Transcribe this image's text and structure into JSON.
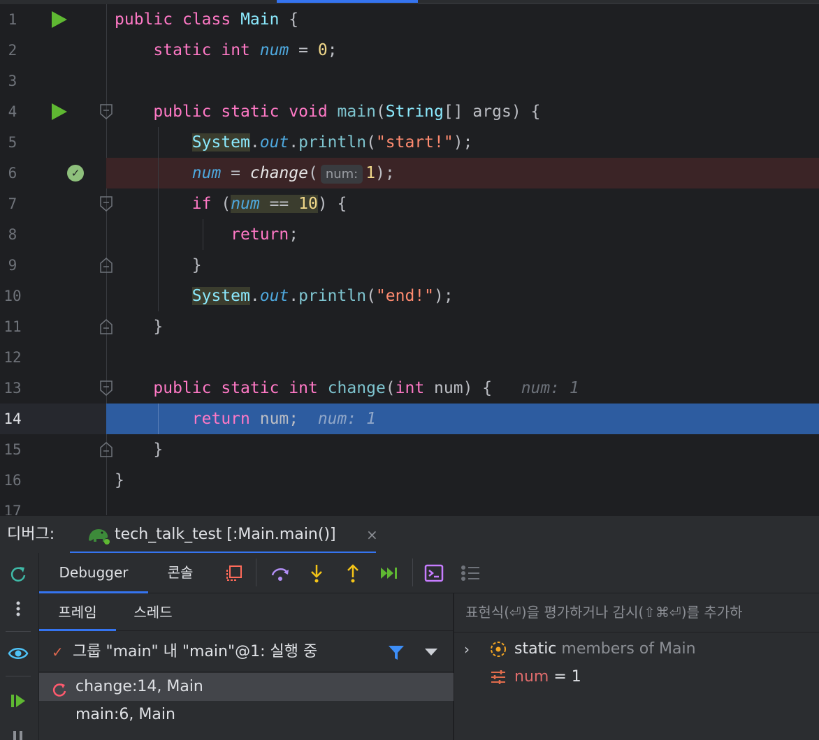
{
  "editor": {
    "lines": [
      {
        "no": "1"
      },
      {
        "no": "2"
      },
      {
        "no": "3"
      },
      {
        "no": "4"
      },
      {
        "no": "5"
      },
      {
        "no": "6"
      },
      {
        "no": "7"
      },
      {
        "no": "8"
      },
      {
        "no": "9"
      },
      {
        "no": "10"
      },
      {
        "no": "11"
      },
      {
        "no": "12"
      },
      {
        "no": "13"
      },
      {
        "no": "14"
      },
      {
        "no": "15"
      },
      {
        "no": "16"
      },
      {
        "no": "17"
      }
    ],
    "tokens": {
      "public": "public",
      "class": "class",
      "Main": "Main",
      "open_brace": " {",
      "static": "static",
      "int": "int",
      "num": "num",
      "eq_zero_a": " = ",
      "zero": "0",
      "semi": ";",
      "void": "void",
      "main": "main",
      "paren_open": "(",
      "String": "String",
      "args_rest": "[] args) {",
      "System": "System",
      "dot": ".",
      "out": "out",
      "println": "println",
      "start_str": "\"start!\"",
      "close_semi": ");",
      "assign": " = ",
      "change": "change",
      "hint_num": "num:",
      "one": "1",
      "if": "if",
      "if_open": " (",
      "eqeq": " == ",
      "ten": "10",
      "if_close": ") {",
      "return": "return",
      "close_brace": "}",
      "end_str": "\"end!\"",
      "change_sig_open": "(",
      "change_sig_rest": " num) {",
      "inline_num_13": "num: 1",
      "return_num": " num;",
      "inline_num_14": "num: 1"
    }
  },
  "debug": {
    "title": "디버그:",
    "session_label": "tech_talk_test [:Main.main()]",
    "session_close": "×",
    "tabs": {
      "debugger": "Debugger",
      "console": "콘솔"
    },
    "frames_tabs": {
      "frames": "프레임",
      "threads": "스레드"
    },
    "thread": {
      "check": "✓",
      "label": "그룹 \"main\" 내 \"main\"@1: 실행 중"
    },
    "frames": [
      {
        "label": "change:14, Main"
      },
      {
        "label": "main:6, Main"
      }
    ],
    "eval_placeholder": "표현식(⏎)을 평가하거나 감시(⇧⌘⏎)를 추가하",
    "variables": [
      {
        "chevron": "›",
        "name": "static",
        "desc": "members of Main"
      },
      {
        "name": "num",
        "eq": " = ",
        "value": "1"
      }
    ]
  },
  "colors": {
    "accent": "#3574f0",
    "run_green": "#5fb832",
    "keyword": "#ff79c6",
    "string": "#ff8b70",
    "exec_line": "#2d5ca0",
    "breakpoint_line": "#3b2426"
  },
  "icons": [
    "run-icon",
    "breakpoint-verified-icon",
    "fold-icon",
    "gradle-elephant-icon",
    "close-icon",
    "rerun-icon",
    "more-icon",
    "watch-eye-icon",
    "resume-icon",
    "pause-icon",
    "layout-icon",
    "step-over-icon",
    "step-into-icon",
    "step-out-icon",
    "run-to-cursor-icon",
    "evaluate-icon",
    "threads-view-icon",
    "filter-icon",
    "dropdown-icon",
    "frame-current-icon",
    "static-members-icon",
    "field-variable-icon"
  ]
}
